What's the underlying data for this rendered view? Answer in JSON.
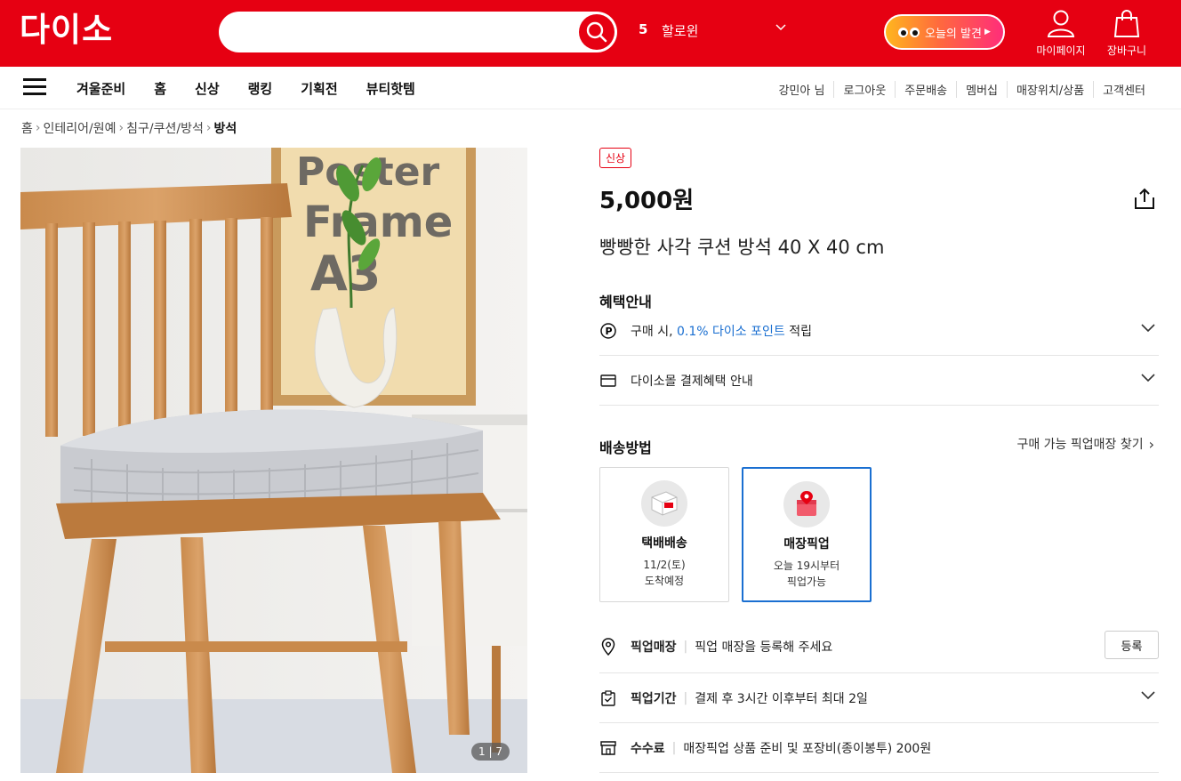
{
  "header": {
    "logo": "다이소",
    "search_placeholder": "",
    "trending_rank": "5",
    "trending_word": "할로윈",
    "discover_label": "오늘의 발견",
    "mypage_label": "마이페이지",
    "cart_label": "장바구니",
    "brand_color": "#e60012"
  },
  "nav": {
    "menu": [
      "겨울준비",
      "홈",
      "신상",
      "랭킹",
      "기획전",
      "뷰티핫템"
    ],
    "util": [
      "강민아 님",
      "로그아웃",
      "주문배송",
      "멤버십",
      "매장위치/상품",
      "고객센터"
    ]
  },
  "breadcrumb": [
    "홈",
    "인테리어/원예",
    "침구/쿠션/방석",
    "방석"
  ],
  "gallery": {
    "pager": "1 | 7"
  },
  "product": {
    "badge": "신상",
    "price": "5,000원",
    "name": "빵빵한 사각 쿠션 방석 40 X 40 cm"
  },
  "benefits": {
    "title": "혜택안내",
    "point_prefix": "구매 시, ",
    "point_highlight": "0.1% 다이소 포인트",
    "point_suffix": " 적립",
    "payment": "다이소몰 결제혜택 안내"
  },
  "delivery": {
    "title": "배송방법",
    "find_link": "구매 가능 픽업매장 찾기",
    "options": [
      {
        "title": "택배배송",
        "line1": "11/2(토)",
        "line2": "도착예정",
        "selected": false
      },
      {
        "title": "매장픽업",
        "line1": "오늘 19시부터",
        "line2": "픽업가능",
        "selected": true
      }
    ]
  },
  "pickup": {
    "store_label": "픽업매장",
    "store_text": "픽업 매장을 등록해 주세요",
    "register_button": "등록",
    "period_label": "픽업기간",
    "period_text": "결제 후 3시간 이후부터 최대 2일",
    "fee_label": "수수료",
    "fee_text": "매장픽업 상품 준비 및 포장비(종이봉투) 200원"
  }
}
